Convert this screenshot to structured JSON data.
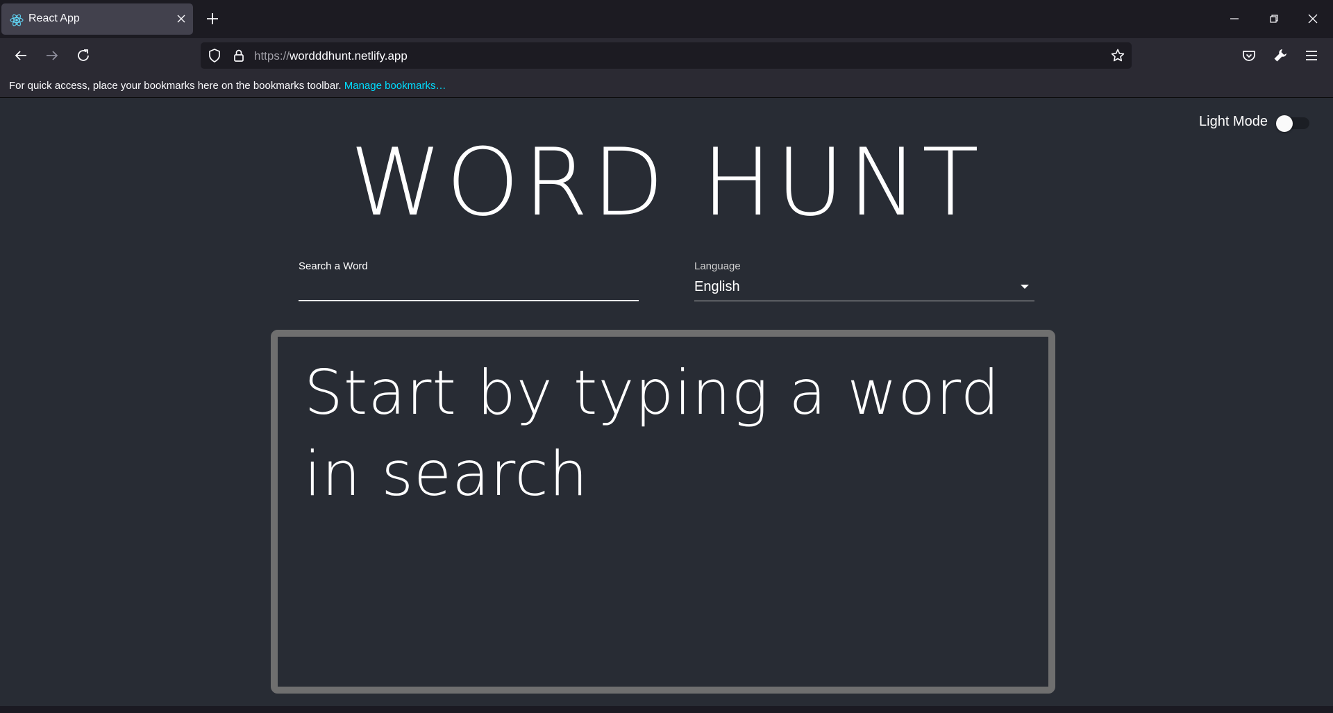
{
  "browser": {
    "tab": {
      "title": "React App"
    },
    "url": {
      "scheme": "https://",
      "host": "wordddhunt.netlify.app"
    },
    "bookmarks_bar": {
      "message": "For quick access, place your bookmarks here on the bookmarks toolbar.",
      "link": "Manage bookmarks…"
    }
  },
  "page": {
    "theme_toggle": {
      "label": "Light Mode",
      "checked": false
    },
    "title": "WORD HUNT",
    "search": {
      "label": "Search a Word",
      "value": ""
    },
    "language": {
      "label": "Language",
      "selected": "English"
    },
    "result": {
      "placeholder": "Start by typing a word in search"
    }
  },
  "colors": {
    "page_background": "#282c34",
    "tab_bar": "#1c1b22",
    "toolbar": "#2b2a33",
    "link": "#00ddff",
    "result_border": "#6f6f6f"
  },
  "icons": [
    "react-favicon-icon",
    "close-icon",
    "plus-icon",
    "minimize-icon",
    "restore-icon",
    "window-close-icon",
    "back-arrow-icon",
    "forward-arrow-icon",
    "reload-icon",
    "shield-icon",
    "lock-icon",
    "star-icon",
    "pocket-icon",
    "wrench-icon",
    "hamburger-menu-icon"
  ]
}
